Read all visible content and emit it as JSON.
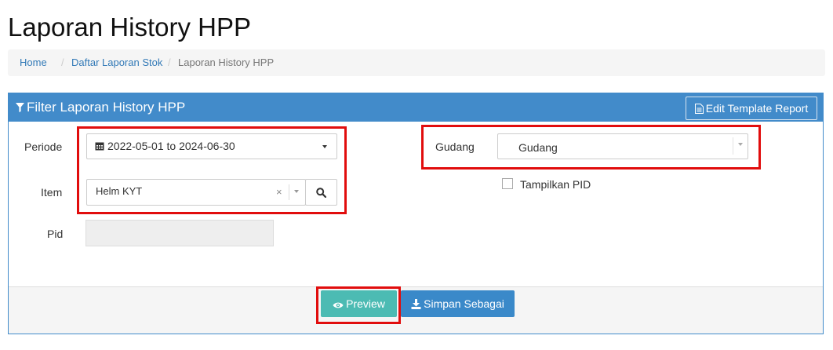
{
  "page": {
    "title": "Laporan History HPP"
  },
  "breadcrumb": {
    "home": "Home",
    "parent": "Daftar Laporan Stok",
    "current": "Laporan History HPP",
    "separator": "/"
  },
  "panel": {
    "title": "Filter Laporan History HPP",
    "edit_template_label": "Edit Template Report"
  },
  "form": {
    "periode_label": "Periode",
    "periode_value": "2022-05-01 to 2024-06-30",
    "item_label": "Item",
    "item_value": "Helm KYT",
    "item_clear": "×",
    "pid_label": "Pid",
    "pid_value": "",
    "gudang_label": "Gudang",
    "gudang_placeholder": "Gudang",
    "tampilkan_pid_label": "Tampilkan PID",
    "tampilkan_pid_checked": false
  },
  "footer": {
    "preview_label": "Preview",
    "simpan_label": "Simpan Sebagai"
  },
  "colors": {
    "primary": "#428bca",
    "preview": "#4cbbb3",
    "simpan": "#3a89c9",
    "highlight": "#e10d0d"
  },
  "icons": [
    "filter-icon",
    "file-text-icon",
    "calendar-icon",
    "search-icon",
    "eye-icon",
    "download-icon"
  ]
}
